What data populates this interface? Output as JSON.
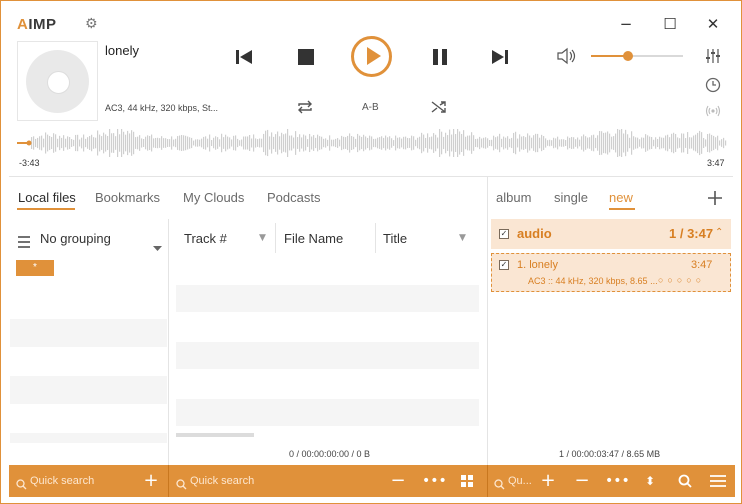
{
  "app": {
    "logo": "IMP",
    "logo_prefix": "A"
  },
  "window_controls": {
    "minimize": "−",
    "maximize": "☐",
    "close": "✕"
  },
  "now_playing": {
    "title": "lonely",
    "info": "AC3, 44 kHz, 320 kbps, St...",
    "elapsed": "-3:43",
    "duration": "3:47",
    "volume_fraction": 0.4
  },
  "controls": {
    "ab_label": "A-B"
  },
  "library_tabs": [
    {
      "label": "Local files",
      "active": true
    },
    {
      "label": "Bookmarks",
      "active": false
    },
    {
      "label": "My Clouds",
      "active": false
    },
    {
      "label": "Podcasts",
      "active": false
    }
  ],
  "grouping": {
    "label": "No grouping",
    "chip": "*"
  },
  "columns": [
    "Track #",
    "File Name",
    "Title"
  ],
  "library_status": "0 / 00:00:00:00 / 0 B",
  "playlist_tabs": [
    {
      "label": "album",
      "active": false
    },
    {
      "label": "single",
      "active": false
    },
    {
      "label": "new",
      "active": true
    }
  ],
  "playlist": {
    "group": {
      "name": "audio",
      "stats": "1 / 3:47"
    },
    "tracks": [
      {
        "title": "1. lonely",
        "duration": "3:47",
        "info": "AC3 :: 44 kHz, 320 kbps, 8.65 ..."
      }
    ],
    "status": "1 / 00:00:03:47 / 8.65 MB"
  },
  "bottom_bar": {
    "search1_placeholder": "Quick search",
    "search2_placeholder": "Quick search",
    "search3_placeholder": "Qu..."
  },
  "colors": {
    "accent": "#e0913a",
    "highlight": "#fae6d3"
  },
  "icons": [
    "gear-icon",
    "prev-icon",
    "stop-icon",
    "play-icon",
    "pause-icon",
    "next-icon",
    "volume-icon",
    "equalizer-icon",
    "clock-icon",
    "radio-icon",
    "repeat-icon",
    "shuffle-icon",
    "menu-icon",
    "add-icon",
    "remove-icon",
    "more-icon",
    "grid-icon",
    "sort-icon",
    "search-icon",
    "hamburger-icon"
  ]
}
